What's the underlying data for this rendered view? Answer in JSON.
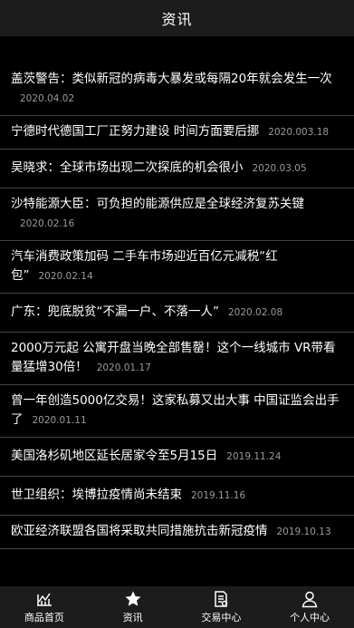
{
  "header": {
    "title": "资讯"
  },
  "news": [
    {
      "title": "盖茨警告：类似新冠的病毒大暴发或每隔20年就会发生一次",
      "date": "2020.04.02",
      "lines": 2
    },
    {
      "title": "宁德时代德国工厂正努力建设 时间方面要后挪",
      "date": "2020.003.18",
      "lines": 2
    },
    {
      "title": "吴晓求：全球市场出现二次探底的机会很小",
      "date": "2020.03.05",
      "lines": 1
    },
    {
      "title": "沙特能源大臣：可负担的能源供应是全球经济复苏关键",
      "date": "2020.02.16",
      "lines": 2
    },
    {
      "title": "汽车消费政策加码 二手车市场迎近百亿元减税“红包”",
      "date": "2020.02.14",
      "lines": 2
    },
    {
      "title": "广东：兜底脱贫“不漏一户、不落一人”",
      "date": "2020.02.08",
      "lines": 1
    },
    {
      "title": "2000万元起 公寓开盘当晚全部售罄！这个一线城市 VR带看量猛增30倍！",
      "date": "2020.01.17",
      "lines": 2
    },
    {
      "title": "曾一年创造5000亿交易！这家私募又出大事 中国证监会出手了",
      "date": "2020.01.11",
      "lines": 2
    },
    {
      "title": "美国洛杉矶地区延长居家令至5月15日",
      "date": "2019.11.24",
      "lines": 1
    },
    {
      "title": "世卫组织：埃博拉疫情尚未结束",
      "date": "2019.11.16",
      "lines": 1
    },
    {
      "title": "欧亚经济联盟各国将采取共同措施抗击新冠疫情",
      "date": "2019.10.13",
      "lines": 2
    }
  ],
  "tabbar": [
    {
      "label": "商品首页",
      "icon": "chart-icon"
    },
    {
      "label": "资讯",
      "icon": "star-icon"
    },
    {
      "label": "交易中心",
      "icon": "document-icon"
    },
    {
      "label": "个人中心",
      "icon": "person-icon"
    }
  ]
}
